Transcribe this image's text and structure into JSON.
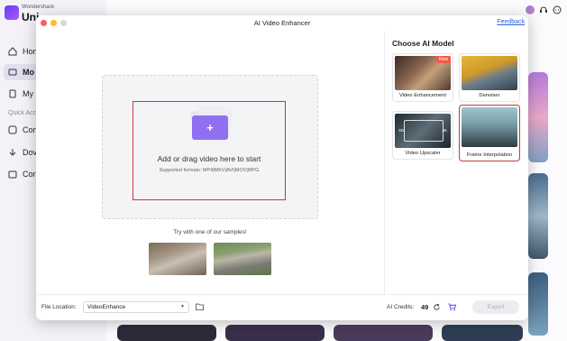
{
  "app": {
    "brand_small": "Wondershare",
    "brand_big": "Uni",
    "sidebar": {
      "items": [
        {
          "label": "Hom",
          "icon": "home-icon"
        },
        {
          "label": "Mo",
          "icon": "video-icon",
          "active": true
        },
        {
          "label": "My",
          "icon": "file-icon"
        }
      ],
      "section_label": "Quick Acc",
      "quick_items": [
        {
          "label": "Con",
          "icon": "convert-icon"
        },
        {
          "label": "Dov",
          "icon": "download-icon"
        },
        {
          "label": "Con",
          "icon": "compress-icon"
        }
      ]
    },
    "header_icons": [
      "avatar",
      "headset-icon",
      "chat-icon"
    ]
  },
  "modal": {
    "title": "AI Video Enhancer",
    "feedback_label": "Feedback",
    "drop_zone": {
      "title": "Add or drag video here to start",
      "supported": "Supported formats: MP4|MKV|AVI|MOV|MPG",
      "icon": "add-folder-icon",
      "plus": "+"
    },
    "samples_label": "Try with one of our samples!",
    "models_title": "Choose AI Model",
    "models": [
      {
        "label": "Video Enhancement",
        "badge": "New"
      },
      {
        "label": "Denoiser"
      },
      {
        "label": "Video Upscaler",
        "tags": [
          "SD",
          "4K"
        ]
      },
      {
        "label": "Frame Interpolation",
        "selected": true
      }
    ],
    "footer": {
      "file_location_label": "File Location:",
      "file_location_value": "VideoEnhance",
      "credits_label": "AI Credits:",
      "credits_value": "49",
      "export_label": "Export"
    }
  },
  "colors": {
    "accent": "#8f70f2",
    "highlight": "#c0393b",
    "link": "#2a63d8"
  }
}
